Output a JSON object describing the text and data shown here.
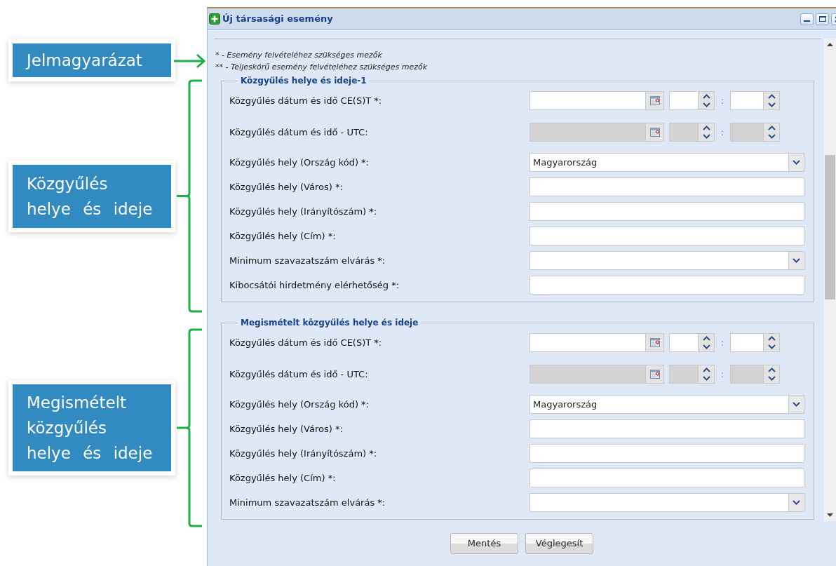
{
  "window": {
    "title": "Új társasági esemény"
  },
  "notes": [
    "* - Esemény felvételéhez szükséges mezők",
    "** - Teljeskörű esemény felvételéhez szükséges mezők"
  ],
  "sections": [
    {
      "title": "Közgyűlés helye és ideje-1",
      "fields": [
        {
          "kind": "datetime",
          "label": "Közgyűlés dátum és idő CE(S)T *:",
          "disabled": false,
          "separator": ":"
        },
        {
          "kind": "datetime",
          "label": "Közgyűlés dátum és idő - UTC:",
          "disabled": true,
          "separator": ":"
        },
        {
          "kind": "select",
          "label": "Közgyűlés hely (Ország kód) *:",
          "value": "Magyarország"
        },
        {
          "kind": "text",
          "label": "Közgyűlés hely (Város) *:"
        },
        {
          "kind": "text",
          "label": "Közgyűlés hely (Irányítószám) *:"
        },
        {
          "kind": "text",
          "label": "Közgyűlés hely (Cím) *:"
        },
        {
          "kind": "select",
          "label": "Minimum szavazatszám elvárás *:"
        },
        {
          "kind": "text",
          "label": "Kibocsátói hirdetmény elérhetőség *:"
        }
      ]
    },
    {
      "title": "Megismételt közgyűlés helye és ideje",
      "fields": [
        {
          "kind": "datetime",
          "label": "Közgyűlés dátum és idő CE(S)T *:",
          "disabled": false,
          "separator": ":"
        },
        {
          "kind": "datetime",
          "label": "Közgyűlés dátum és idő - UTC:",
          "disabled": true,
          "separator": ":"
        },
        {
          "kind": "select",
          "label": "Közgyűlés hely (Ország kód) *:",
          "value": "Magyarország"
        },
        {
          "kind": "text",
          "label": "Közgyűlés hely (Város) *:"
        },
        {
          "kind": "text",
          "label": "Közgyűlés hely (Irányítószám) *:"
        },
        {
          "kind": "text",
          "label": "Közgyűlés hely (Cím) *:"
        },
        {
          "kind": "select",
          "label": "Minimum szavazatszám elvárás *:"
        }
      ]
    }
  ],
  "buttons": [
    "Mentés",
    "Véglegesít"
  ],
  "annotations": [
    {
      "kind": "arrow",
      "lines": [
        "Jelmagyarázat"
      ]
    },
    {
      "kind": "bracket",
      "lines": [
        "Közgyűlés",
        "helye és ideje"
      ]
    },
    {
      "kind": "bracket",
      "lines": [
        "Megismételt",
        "közgyűlés",
        "helye és ideje"
      ]
    }
  ]
}
